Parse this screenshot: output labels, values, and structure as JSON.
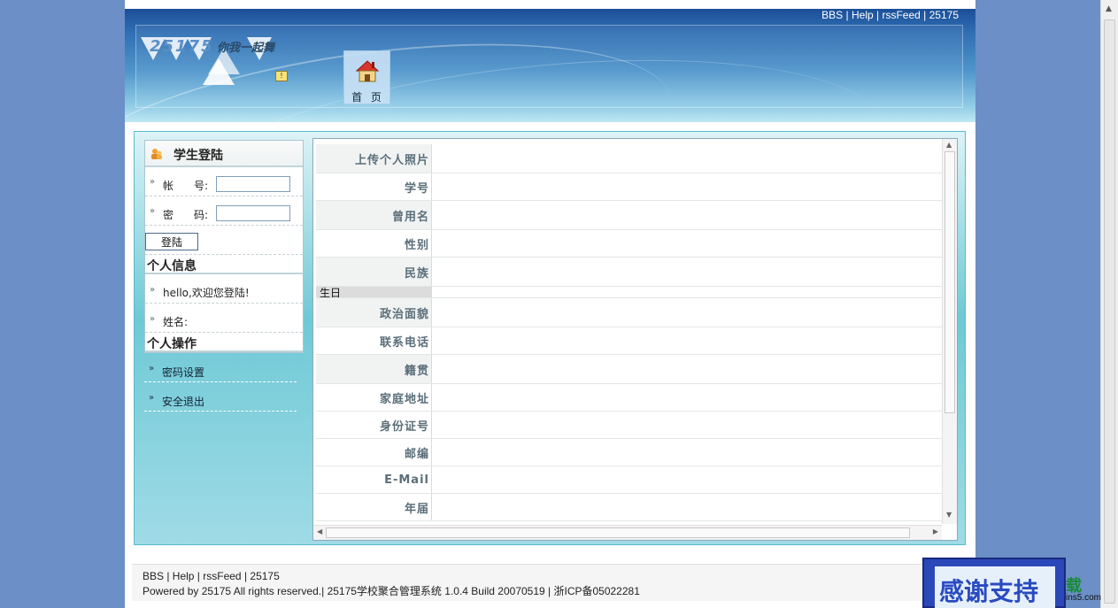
{
  "header": {
    "links": [
      "BBS",
      "Help",
      "rssFeed",
      "25175"
    ],
    "logo_number": "25175",
    "logo_slogan": "你我一起舞",
    "nav_home": "首 页"
  },
  "login": {
    "title": "学生登陆",
    "account_label_a": "帐",
    "account_label_b": "号:",
    "password_label_a": "密",
    "password_label_b": "码:",
    "account_value": "",
    "password_value": "",
    "submit": "登陆"
  },
  "personal_info": {
    "title": "个人信息",
    "welcome": "hello,欢迎您登陆!",
    "name_label": "姓名:"
  },
  "personal_ops": {
    "title": "个人操作",
    "items": [
      "密码设置",
      "安全退出"
    ]
  },
  "form": {
    "rows": [
      {
        "label": "上传个人照片"
      },
      {
        "label": "学号"
      },
      {
        "label": "曾用名"
      },
      {
        "label": "性别"
      },
      {
        "label": "民族"
      },
      {
        "label": "生日"
      },
      {
        "label": "政治面貌"
      },
      {
        "label": "联系电话"
      },
      {
        "label": "籍贯"
      },
      {
        "label": "家庭地址"
      },
      {
        "label": "身份证号"
      },
      {
        "label": "邮编"
      },
      {
        "label": "E-Mail"
      },
      {
        "label": "年届"
      }
    ]
  },
  "footer": {
    "line1": "BBS | Help | rssFeed | 25175",
    "line2": "Powered by 25175 All rights reserved.| 25175学校聚合管理系统  1.0.4 Build 20070519 | 浙ICP备05022281"
  },
  "overlay": {
    "thanks": "感谢支持",
    "watermark_big": "载",
    "watermark_small": "ins5.com"
  },
  "colors": {
    "background": "#6b8fc6",
    "header_top": "#1b4f98",
    "content_teal": "#6fc9d6",
    "label_text": "#5b6f7a"
  }
}
